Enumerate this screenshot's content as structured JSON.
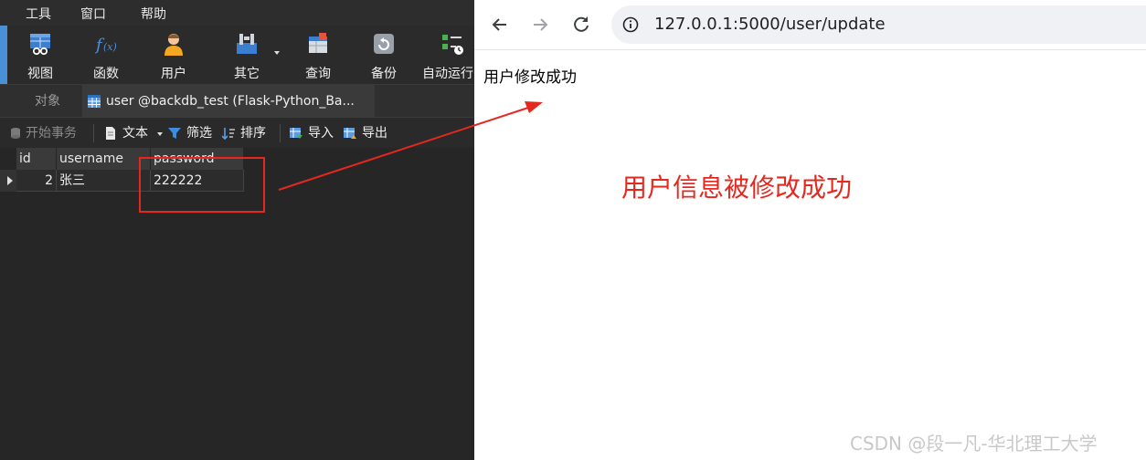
{
  "navicat": {
    "menu": [
      "工具",
      "窗口",
      "帮助"
    ],
    "toolbar": [
      {
        "label": "视图",
        "icon": "view-icon"
      },
      {
        "label": "函数",
        "icon": "function-icon"
      },
      {
        "label": "用户",
        "icon": "user-icon"
      },
      {
        "label": "其它",
        "icon": "other-tools-icon"
      },
      {
        "label": "查询",
        "icon": "query-icon"
      },
      {
        "label": "备份",
        "icon": "backup-icon"
      },
      {
        "label": "自动运行",
        "icon": "automation-icon"
      }
    ],
    "tabs": {
      "objects": "对象",
      "active": "user @backdb_test (Flask-Python_Ba..."
    },
    "subtoolbar": {
      "begin_transaction": "开始事务",
      "text": "文本",
      "filter": "筛选",
      "sort": "排序",
      "import": "导入",
      "export": "导出"
    },
    "table": {
      "columns": [
        "id",
        "username",
        "password"
      ],
      "rows": [
        {
          "id": "2",
          "username": "张三",
          "password": "222222"
        }
      ]
    },
    "colors": {
      "accent": "#4a90d9",
      "highlight": "#e5281f"
    }
  },
  "browser": {
    "url": "127.0.0.1:5000/user/update",
    "page_message": "用户修改成功"
  },
  "annotation": {
    "text": "用户信息被修改成功",
    "color": "#e5281f"
  },
  "watermark": "CSDN @段一凡-华北理工大学"
}
